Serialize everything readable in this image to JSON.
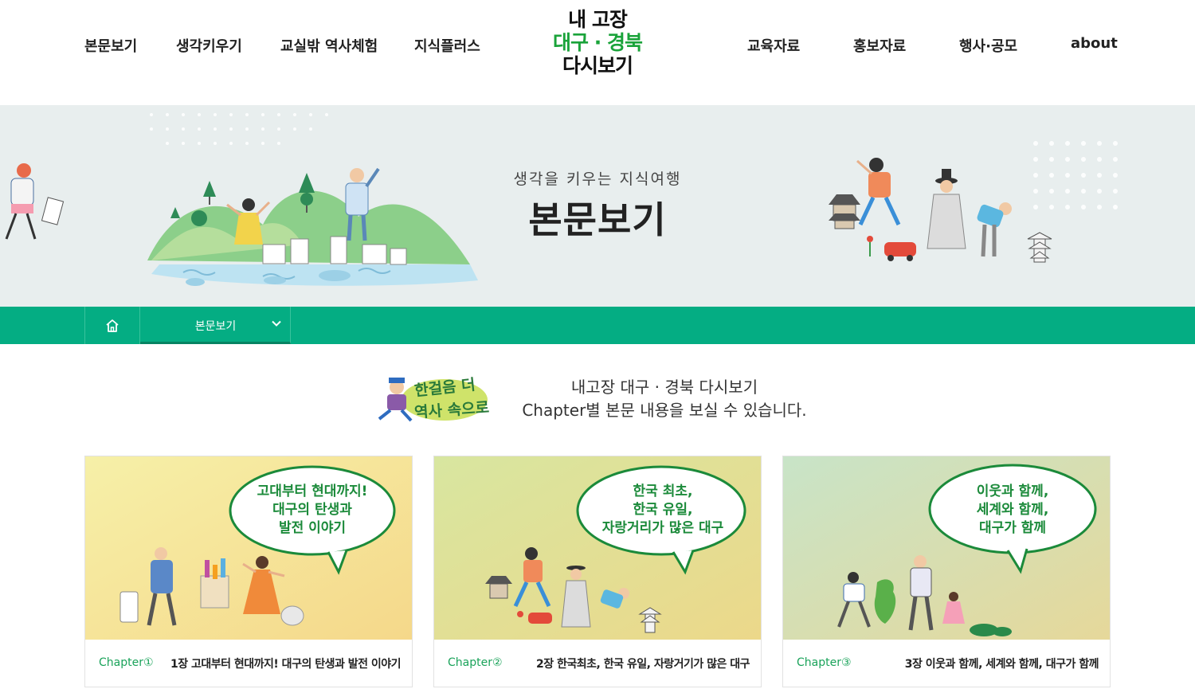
{
  "header": {
    "nav_left": [
      "본문보기",
      "생각키우기",
      "교실밖 역사체험",
      "지식플러스"
    ],
    "nav_right": [
      "교육자료",
      "홍보자료",
      "행사·공모",
      "about"
    ],
    "logo": {
      "line1": "내 고장",
      "line2": "대구 · 경북",
      "line3": "다시보기"
    }
  },
  "hero": {
    "subtitle": "생각을 키우는 지식여행",
    "title": "본문보기"
  },
  "breadcrumb": {
    "current": "본문보기"
  },
  "intro": {
    "badge_text": [
      "한걸음 더",
      "역사 속으로"
    ],
    "line1": "내고장 대구 · 경북 다시보기",
    "line2": "Chapter별 본문 내용을 보실 수 있습니다."
  },
  "cards": [
    {
      "chapter": "Chapter①",
      "title": "1장 고대부터 현대까지! 대구의 탄생과 발전 이야기",
      "bubble": [
        "고대부터 현대까지!",
        "대구의 탄생과",
        "발전 이야기"
      ]
    },
    {
      "chapter": "Chapter②",
      "title": "2장 한국최초, 한국 유일, 자랑거기가 많은 대구",
      "bubble": [
        "한국 최초,",
        "한국 유일,",
        "자랑거리가 많은 대구"
      ]
    },
    {
      "chapter": "Chapter③",
      "title": "3장 이웃과 함께, 세계와 함께, 대구가 함께",
      "bubble": [
        "이웃과 함께,",
        "세계와 함께,",
        "대구가 함께"
      ]
    }
  ],
  "colors": {
    "accent_green": "#04ad83",
    "logo_green": "#1aa33a",
    "bubble_green": "#1b8a3a",
    "hero_bg": "#e8eeee"
  }
}
